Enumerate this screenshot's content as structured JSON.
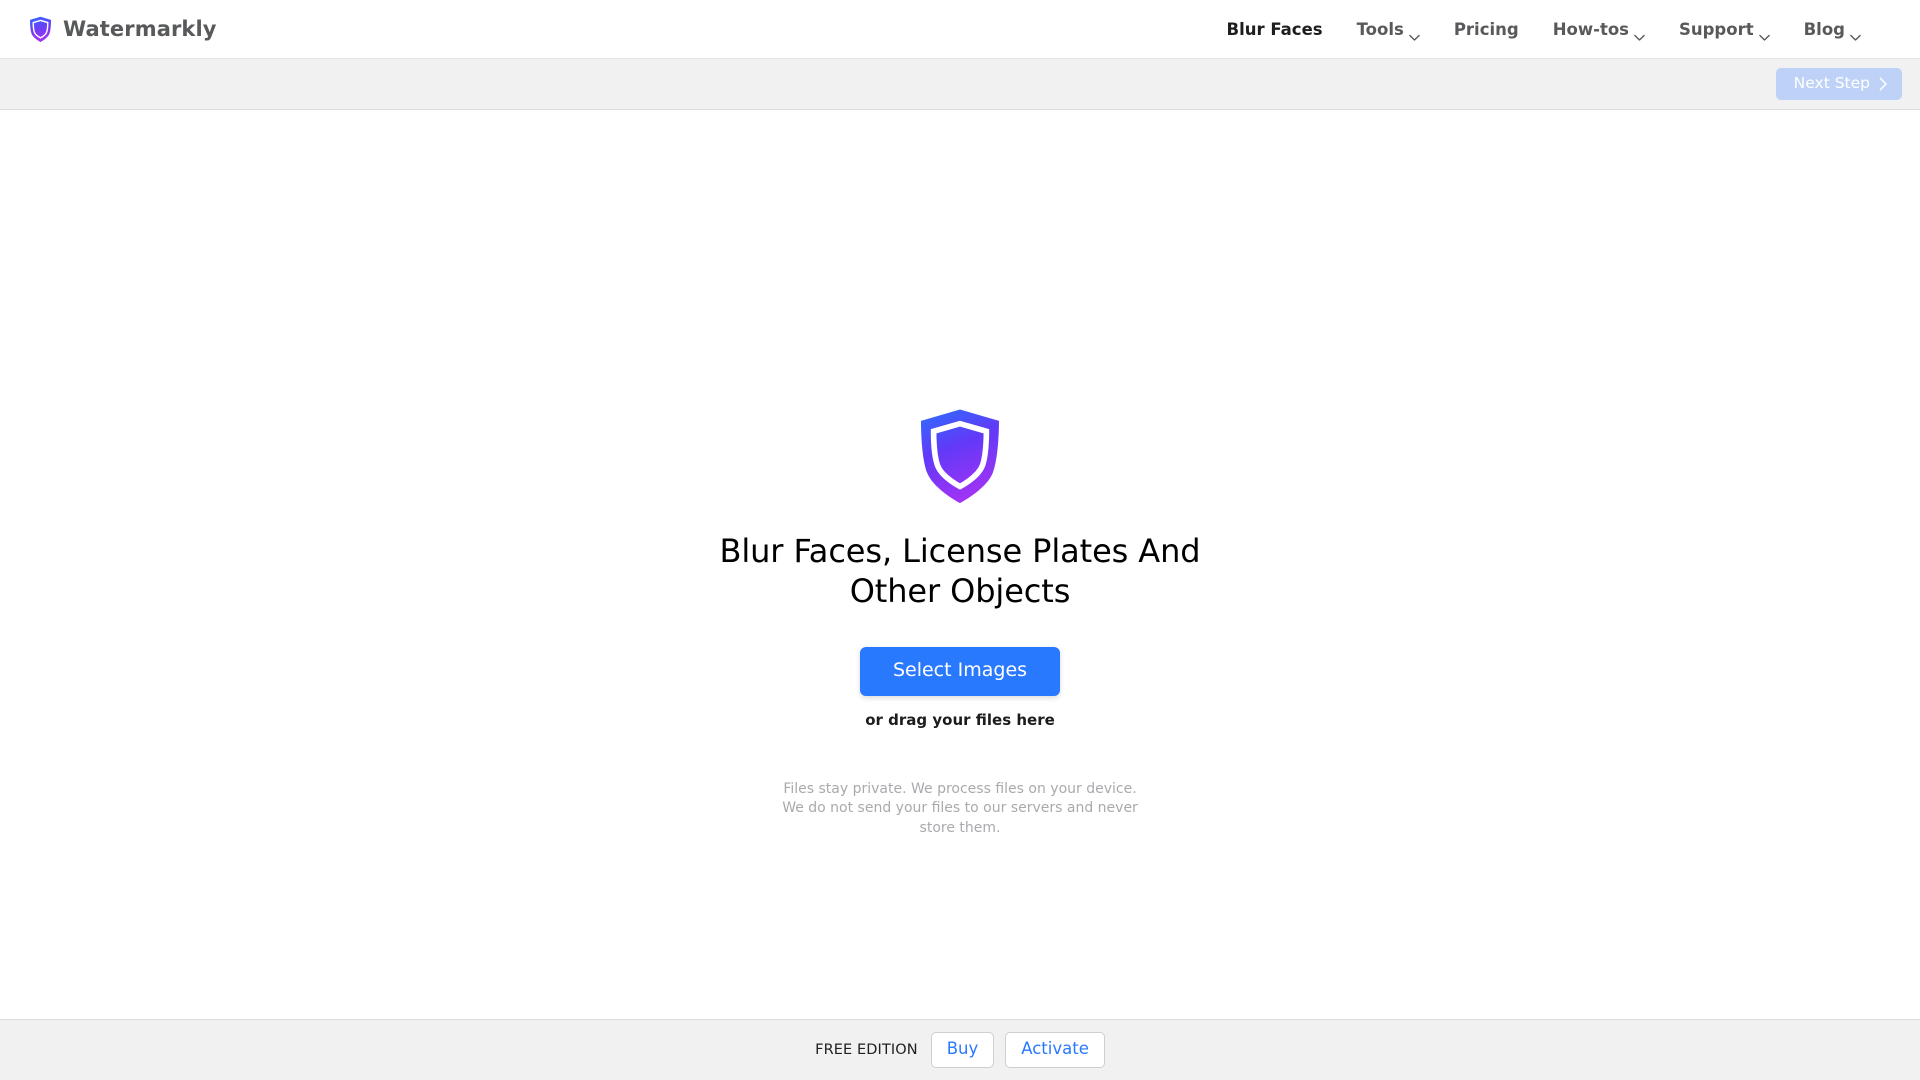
{
  "header": {
    "brand": {
      "name": "Watermarkly",
      "logo_icon": "shield-icon"
    },
    "nav": [
      {
        "label": "Blur Faces",
        "icon": "",
        "active": true
      },
      {
        "label": "Tools",
        "icon": "chevron-down-icon",
        "active": false
      },
      {
        "label": "Pricing",
        "icon": "",
        "active": false
      },
      {
        "label": "How-tos",
        "icon": "chevron-down-icon",
        "active": false
      },
      {
        "label": "Support",
        "icon": "chevron-down-icon",
        "active": false
      },
      {
        "label": "Blog",
        "icon": "chevron-down-icon",
        "active": false
      }
    ]
  },
  "toolbar": {
    "next_step_label": "Next Step",
    "next_step_icon": "chevron-right-icon",
    "next_step_disabled": true
  },
  "main": {
    "hero_icon": "shield-icon",
    "title": "Blur Faces, License Plates And Other Objects",
    "select_images_label": "Select Images",
    "drag_hint": "or drag your files here",
    "privacy_note": "Files stay private. We process files on your device. We do not send your files to our servers and never store them."
  },
  "footer": {
    "edition_label": "FREE EDITION",
    "buy_label": "Buy",
    "activate_label": "Activate"
  },
  "colors": {
    "accent_blue": "#2979ff",
    "disabled_blue": "#bed2f7",
    "shield_top": "#2f6bff",
    "shield_bottom": "#a033f5",
    "panel_gray": "#f1f1f1",
    "border_gray": "#dcdcdc",
    "muted_text": "#aaaaae",
    "nav_text": "#58595b"
  }
}
